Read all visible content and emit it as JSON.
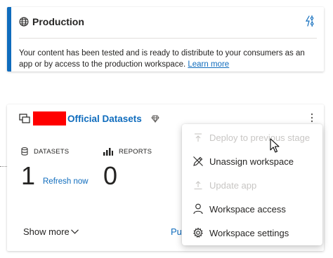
{
  "production": {
    "title": "Production",
    "description": "Your content has been tested and is ready to distribute to your consumers as an app or by access to the production workspace.",
    "learn_more": "Learn more"
  },
  "stage": {
    "workspace_name": "Official Datasets",
    "datasets_label": "DATASETS",
    "datasets_count": "1",
    "refresh_label": "Refresh now",
    "reports_label": "REPORTS",
    "reports_count": "0",
    "show_more": "Show more",
    "partial_button": "Pu"
  },
  "menu": {
    "items": [
      {
        "label": "Deploy to previous stage",
        "disabled": true,
        "icon": "deploy-previous-icon"
      },
      {
        "label": "Unassign workspace",
        "disabled": false,
        "icon": "pencil-unassign-icon"
      },
      {
        "label": "Update app",
        "disabled": true,
        "icon": "update-app-icon"
      },
      {
        "label": "Workspace access",
        "disabled": false,
        "icon": "person-icon"
      },
      {
        "label": "Workspace settings",
        "disabled": false,
        "icon": "gear-icon"
      }
    ]
  },
  "colors": {
    "accent": "#0f6cbd",
    "redaction": "#ff0000",
    "disabled_text": "#c8c6c4"
  }
}
